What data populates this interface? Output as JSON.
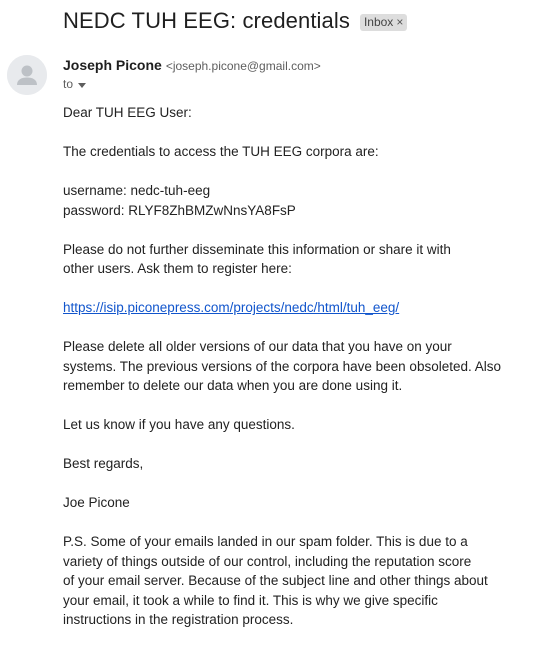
{
  "email": {
    "subject": "NEDC TUH EEG: credentials",
    "label": "Inbox",
    "label_remove": "×",
    "sender": {
      "name": "Joseph Picone",
      "email": "<joseph.picone@gmail.com>"
    },
    "to_label": "to",
    "icons": {
      "avatar": "person-icon",
      "to_caret": "caret-down-icon",
      "label_close": "close-icon"
    },
    "body": {
      "greeting": "Dear TUH EEG User:",
      "credentials_intro": "The credentials to access the TUH EEG corpora are:",
      "username_line": "username: nedc-tuh-eeg",
      "password_line": "password: RLYF8ZhBMZwNnsYA8FsP",
      "disseminate_lines": [
        "Please do not further disseminate this information or share it with",
        "other users. Ask them to register here:"
      ],
      "register_link": "https://isip.piconepress.com/projects/nedc/html/tuh_eeg/",
      "delete_lines": [
        "Please delete all older versions of our data that you have on your",
        "systems. The previous versions of the corpora have been obsoleted. Also",
        "remember to delete our data when you are done using it."
      ],
      "questions": "Let us know if you have any questions.",
      "closing": "Best regards,",
      "signature": "Joe Picone",
      "ps_lines": [
        "P.S. Some of your emails landed in our spam folder. This is due to a",
        "variety of things outside of our control, including the reputation score",
        "of your email server. Because of the subject line and other things about",
        "your email, it took a while to find it. This is why we give specific",
        "instructions in the registration process."
      ]
    }
  }
}
